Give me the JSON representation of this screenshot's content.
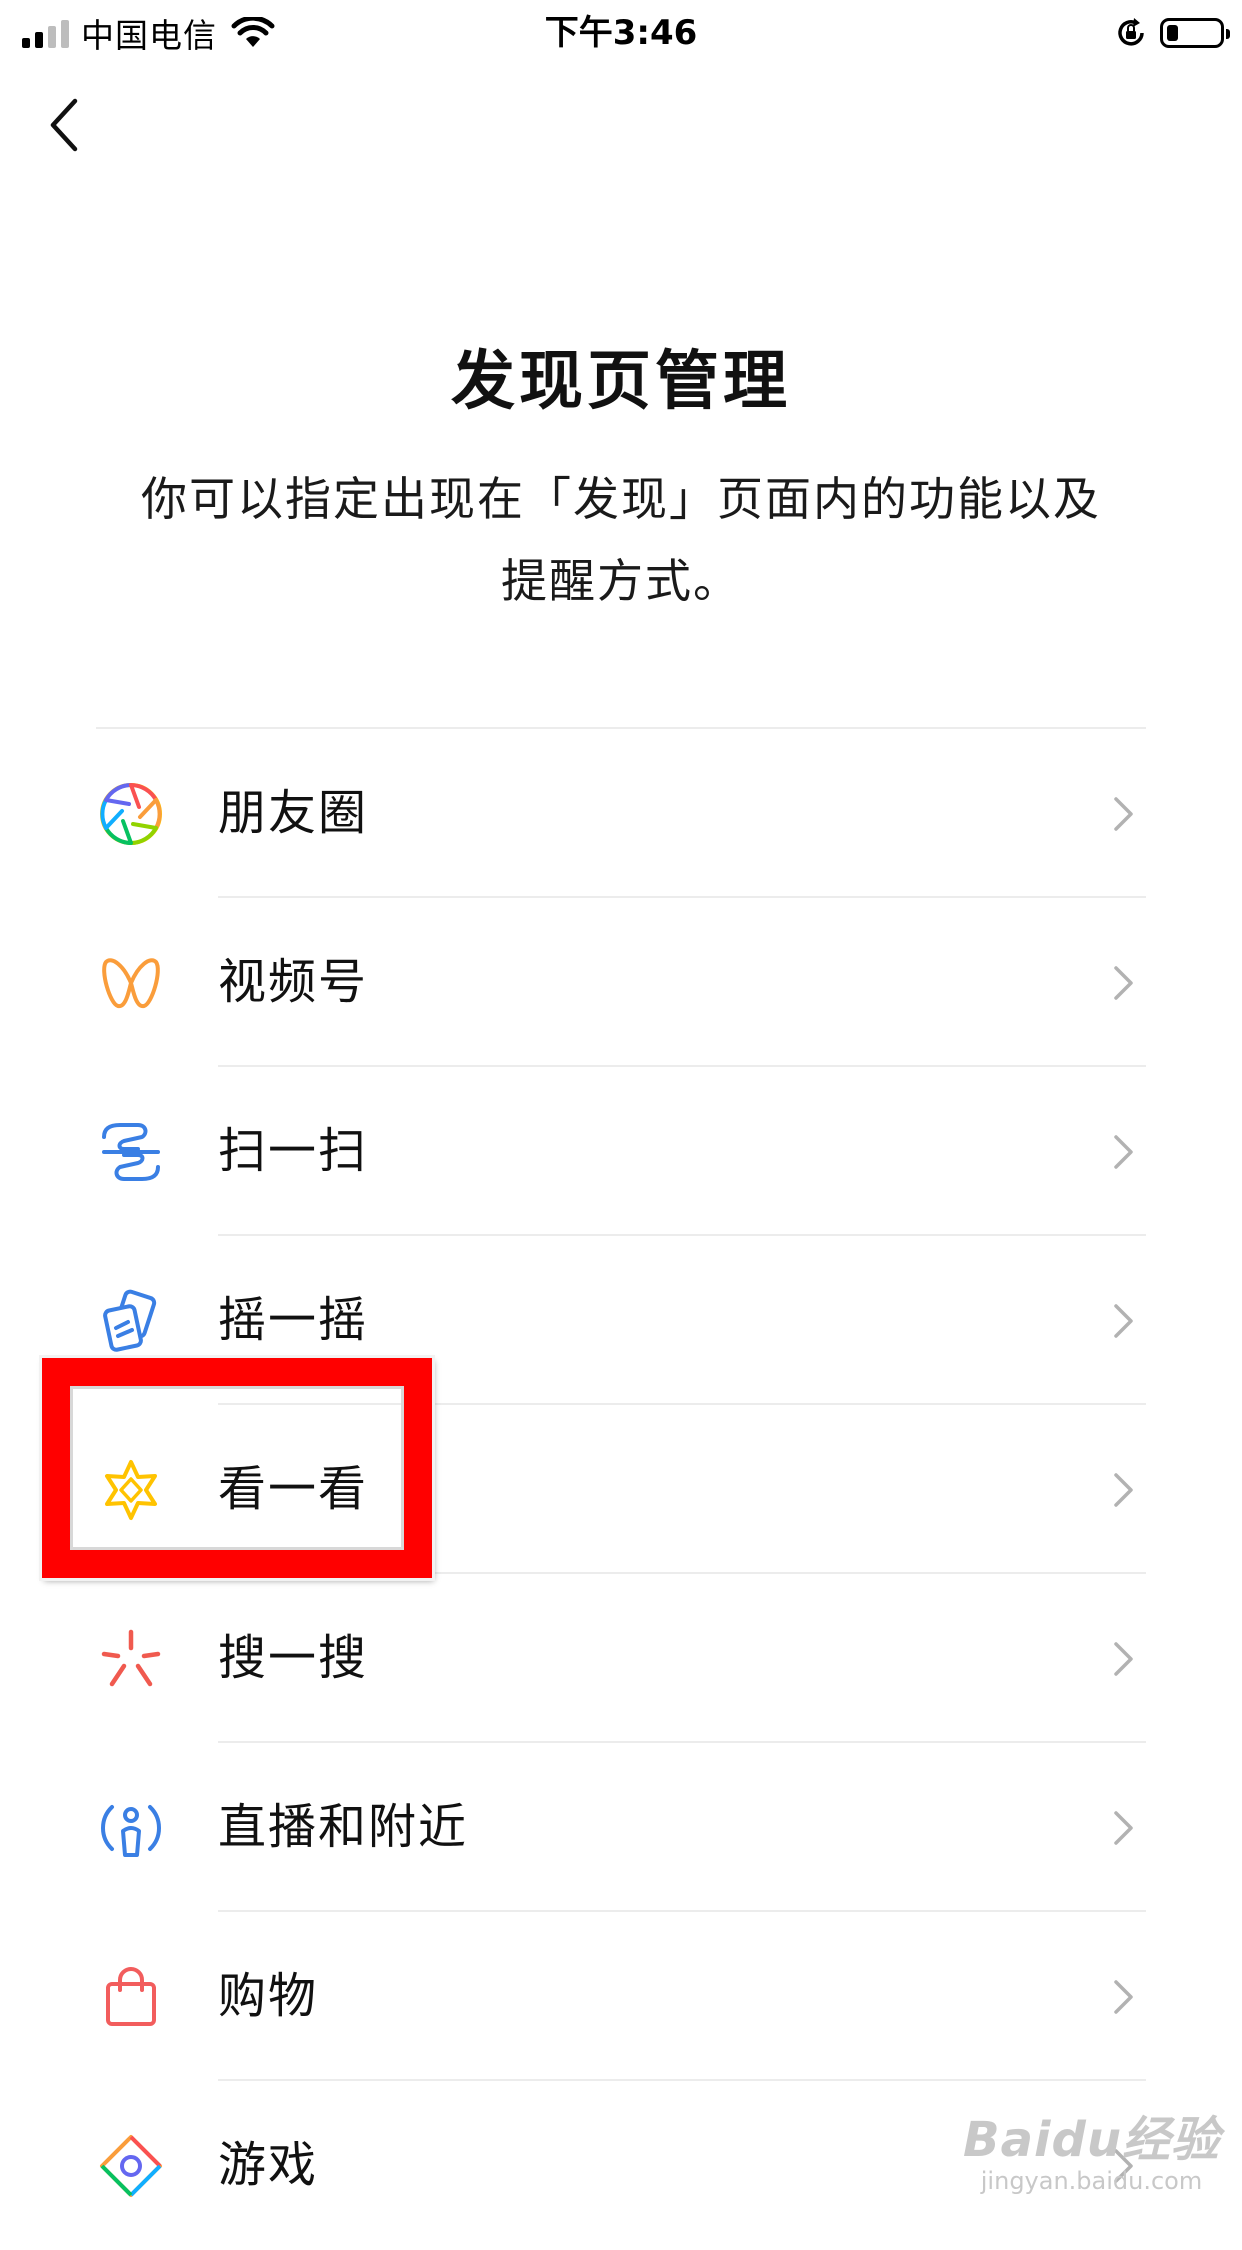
{
  "status_bar": {
    "carrier": "中国电信",
    "time": "下午3:46",
    "battery_level": 0.15
  },
  "header": {
    "title": "发现页管理",
    "description_line1": "你可以指定出现在「发现」页面内的功能以及",
    "description_line2": "提醒方式。"
  },
  "items": [
    {
      "label": "朋友圈",
      "icon": "moments-aperture-icon"
    },
    {
      "label": "视频号",
      "icon": "channels-icon"
    },
    {
      "label": "扫一扫",
      "icon": "scan-icon"
    },
    {
      "label": "摇一摇",
      "icon": "shake-icon"
    },
    {
      "label": "看一看",
      "icon": "top-stories-icon",
      "highlighted": true
    },
    {
      "label": "搜一搜",
      "icon": "search-star-icon"
    },
    {
      "label": "直播和附近",
      "icon": "live-nearby-icon"
    },
    {
      "label": "购物",
      "icon": "shopping-bag-icon"
    },
    {
      "label": "游戏",
      "icon": "games-icon"
    }
  ],
  "colors": {
    "highlight": "#ff0000",
    "channels": "#fa9d3b",
    "scan": "#3a7fe4",
    "top_stories": "#ffc300",
    "search": "#f05a4f",
    "live": "#3a7fe4",
    "shopping": "#f25d5d"
  },
  "watermark": {
    "logo": "Baidu经验",
    "sub": "jingyan.baidu.com"
  }
}
